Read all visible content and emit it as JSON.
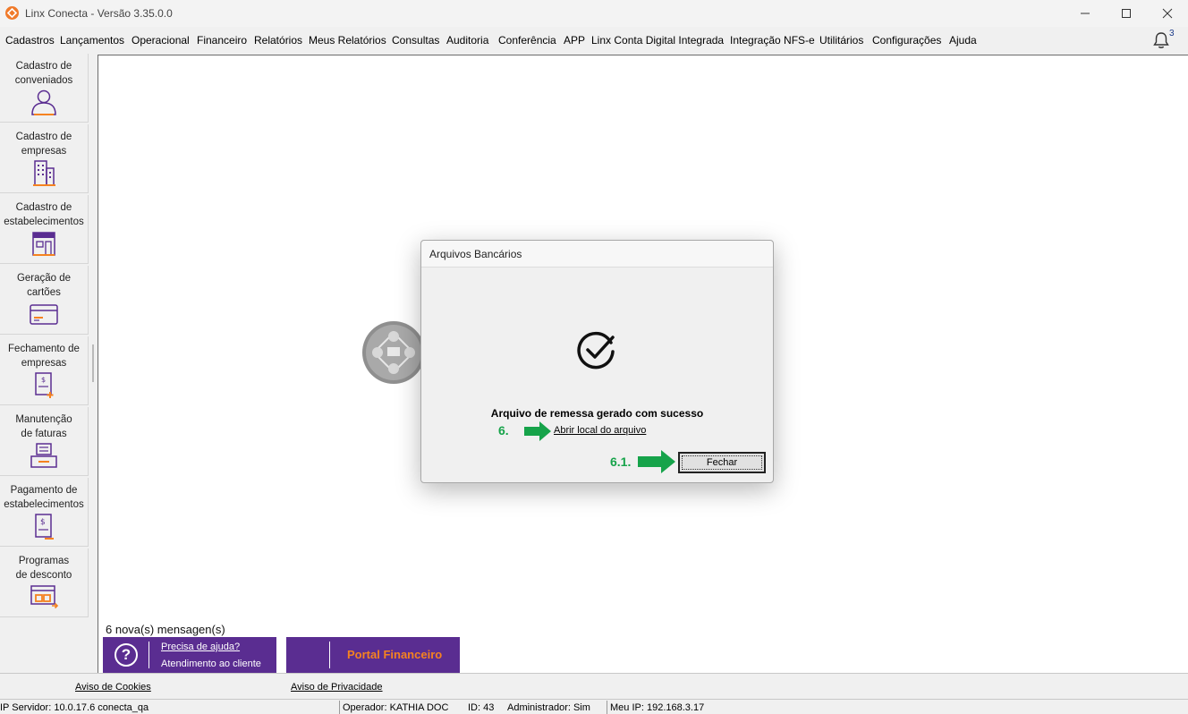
{
  "window": {
    "title": "Linx Conecta - Versão 3.35.0.0"
  },
  "menu": [
    "Cadastros",
    "Lançamentos",
    "Operacional",
    "Financeiro",
    "Relatórios",
    "Meus Relatórios",
    "Consultas",
    "Auditoria",
    "Conferência",
    "APP",
    "Linx Conta Digital Integrada",
    "Integração NFS-e",
    "Utilitários",
    "Configurações",
    "Ajuda"
  ],
  "notifications": {
    "count": "3",
    "icon": "bell-icon"
  },
  "sidebar": {
    "items": [
      {
        "label_line1": "Cadastro de",
        "label_line2": "conveniados",
        "icon": "user-icon"
      },
      {
        "label_line1": "Cadastro de",
        "label_line2": "empresas",
        "icon": "building-icon"
      },
      {
        "label_line1": "Cadastro de",
        "label_line2": "estabelecimentos",
        "icon": "storefront-icon"
      },
      {
        "label_line1": "Geração de",
        "label_line2": "cartões",
        "icon": "card-icon"
      },
      {
        "label_line1": "Fechamento de",
        "label_line2": "empresas",
        "icon": "invoice-plus-icon"
      },
      {
        "label_line1": "Manutenção",
        "label_line2": "de faturas",
        "icon": "inbox-tray-icon"
      },
      {
        "label_line1": "Pagamento de",
        "label_line2": "estabelecimentos",
        "icon": "invoice-dollar-icon"
      },
      {
        "label_line1": "Programas",
        "label_line2": "de desconto",
        "icon": "discount-program-icon"
      }
    ]
  },
  "messages": {
    "text": "6 nova(s) mensagen(s)"
  },
  "help": {
    "line1": "Precisa de ajuda?",
    "line2": "Atendimento ao cliente",
    "symbol": "?"
  },
  "portal": {
    "label": "Portal Financeiro"
  },
  "footer_links": {
    "cookies": "Aviso de Cookies",
    "privacy": "Aviso de Privacidade"
  },
  "status": {
    "server": "IP Servidor: 10.0.17.6 conecta_qa",
    "operator": "Operador: KATHIA DOC",
    "id": "ID: 43",
    "admin": "Administrador: Sim",
    "ip": "Meu IP: 192.168.3.17"
  },
  "dialog": {
    "title": "Arquivos Bancários",
    "message": "Arquivo de remessa gerado com sucesso",
    "link": "Abrir local do arquivo",
    "close_button": "Fechar",
    "step_link": "6.",
    "step_button": "6.1."
  },
  "colors": {
    "brand_purple": "#5a2d91",
    "brand_orange": "#f58220",
    "annotation_green": "#16a34a"
  }
}
